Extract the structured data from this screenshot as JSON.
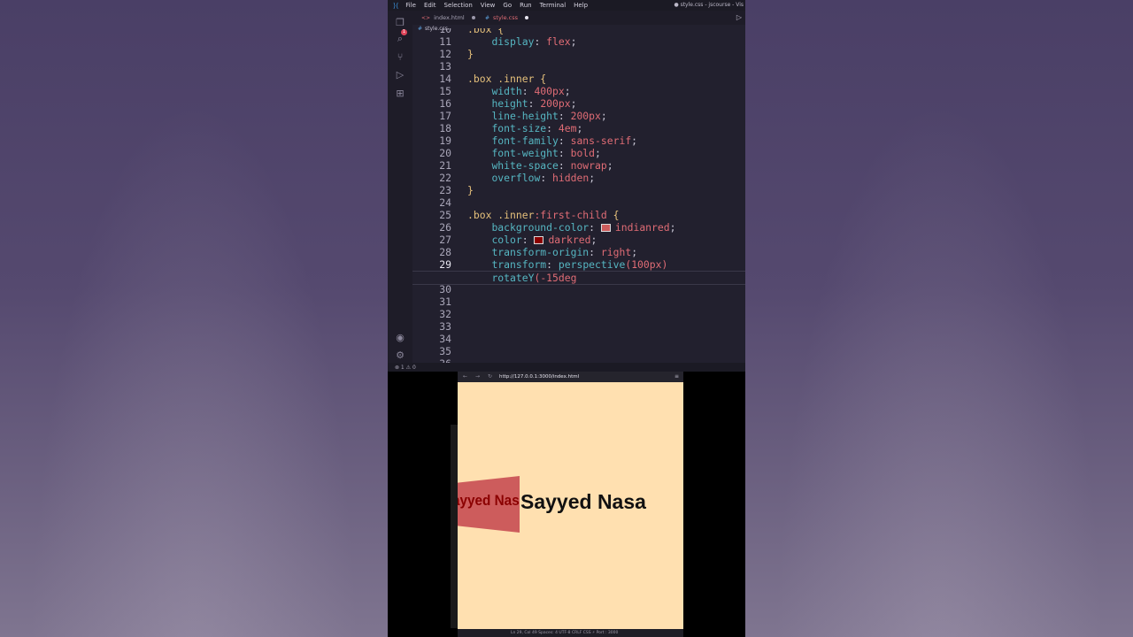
{
  "menubar": {
    "items": [
      "File",
      "Edit",
      "Selection",
      "View",
      "Go",
      "Run",
      "Terminal",
      "Help"
    ],
    "window_title": "● style.css - jscourse - Vis"
  },
  "tabs": [
    {
      "label": "index.html",
      "icon": "code-brackets-icon"
    },
    {
      "label": "style.css",
      "icon": "hash-icon",
      "color": "#e06c75"
    }
  ],
  "breadcrumb": {
    "file": "style.css"
  },
  "editor": {
    "lines": [
      {
        "n": "10",
        "text": ".box {"
      },
      {
        "n": "11",
        "text": "    display: flex;"
      },
      {
        "n": "12",
        "text": "}"
      },
      {
        "n": "13",
        "text": ""
      },
      {
        "n": "14",
        "text": ".box .inner {"
      },
      {
        "n": "15",
        "text": "    width: 400px;"
      },
      {
        "n": "16",
        "text": "    height: 200px;"
      },
      {
        "n": "17",
        "text": "    line-height: 200px;"
      },
      {
        "n": "18",
        "text": "    font-size: 4em;"
      },
      {
        "n": "19",
        "text": "    font-family: sans-serif;"
      },
      {
        "n": "20",
        "text": "    font-weight: bold;"
      },
      {
        "n": "21",
        "text": "    white-space: nowrap;"
      },
      {
        "n": "22",
        "text": "    overflow: hidden;"
      },
      {
        "n": "23",
        "text": "}"
      },
      {
        "n": "24",
        "text": ""
      },
      {
        "n": "25",
        "text": ".box .inner:first-child {"
      },
      {
        "n": "26",
        "text": "    background-color: indianred;"
      },
      {
        "n": "27",
        "text": "    color: darkred;"
      },
      {
        "n": "28",
        "text": "    transform-origin: right;"
      },
      {
        "n": "29",
        "text": "    transform: perspective(100px)"
      },
      {
        "n": "",
        "text": "    rotateY(-15deg"
      },
      {
        "n": "30",
        "text": ""
      },
      {
        "n": "31",
        "text": ""
      },
      {
        "n": "32",
        "text": ""
      },
      {
        "n": "33",
        "text": ""
      },
      {
        "n": "34",
        "text": ""
      },
      {
        "n": "35",
        "text": ""
      },
      {
        "n": "36",
        "text": ""
      }
    ]
  },
  "statusbar": {
    "left": "⊗ 1 ⚠ 0"
  },
  "browser": {
    "url": "http://127.0.0.1:3000/index.html",
    "rotated_text": "ayyed Nasa",
    "flat_text": "Sayyed Nasa",
    "status": "Ln 29, Col 49   Spaces: 4   UTF-8   CRLF   CSS   ⚡ Port : 3000"
  },
  "colors": {
    "indianred": "#cd5c5c",
    "darkred": "#8b0000",
    "page_bg": "#ffe0b0"
  }
}
